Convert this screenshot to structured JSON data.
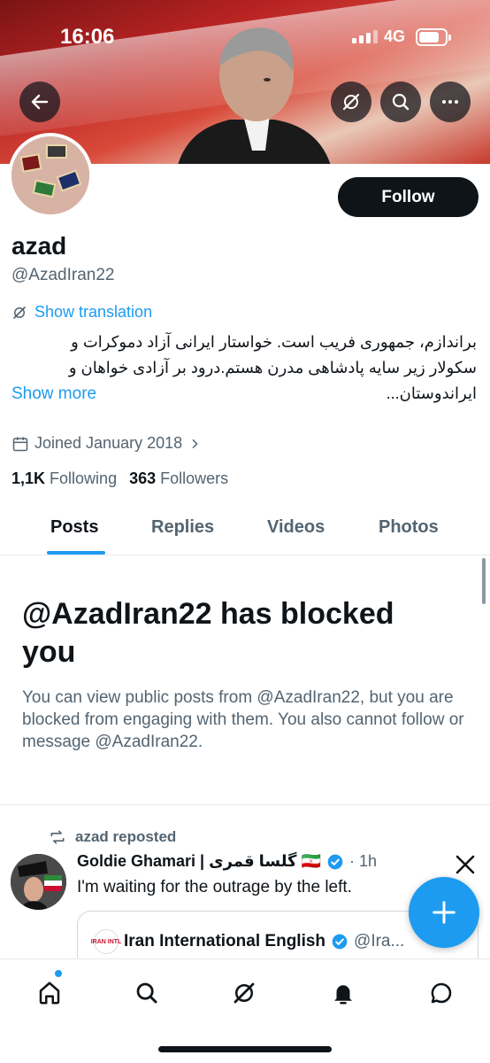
{
  "status_bar": {
    "time": "16:06",
    "network": "4G"
  },
  "header": {
    "back_icon": "arrow-left-icon",
    "actions": [
      "grok-icon",
      "search-icon",
      "more-icon"
    ]
  },
  "profile": {
    "name": "azad",
    "handle": "@AzadIran22",
    "follow_label": "Follow",
    "show_translation": "Show translation",
    "bio_line1": "براندازم، جمهوری فریب است. خواستار ایرانی آزاد دموکرات و",
    "bio_line2": "سکولار زیر سایه پادشاهی مدرن هستم.درود بر آزادی خواهان و",
    "bio_line3": "ایراندوستان...",
    "show_more": "Show more",
    "joined": "Joined January 2018",
    "following_count": "1,1K",
    "following_label": "Following",
    "followers_count": "363",
    "followers_label": "Followers"
  },
  "tabs": [
    {
      "label": "Posts",
      "active": true
    },
    {
      "label": "Replies",
      "active": false
    },
    {
      "label": "Videos",
      "active": false
    },
    {
      "label": "Photos",
      "active": false
    }
  ],
  "blocked": {
    "title": "@AzadIran22 has blocked you",
    "text": "You can view public posts from @AzadIran22, but you are blocked from engaging with them. You also cannot follow or message @AzadIran22."
  },
  "post": {
    "repost_label": "azad reposted",
    "author": "Goldie Ghamari | گلسا قمری 🇮🇷",
    "time": "· 1h",
    "text": "I'm waiting for the outrage by the left.",
    "quote_name": "Iran International English",
    "quote_handle": "@Ira...",
    "quote_logo": "IRAN INTL"
  },
  "bottom_nav": [
    "home-icon",
    "search-icon",
    "grok-icon",
    "notifications-icon",
    "messages-icon"
  ],
  "colors": {
    "accent": "#1d9bf0",
    "text": "#0f1419",
    "secondary": "#536471"
  }
}
